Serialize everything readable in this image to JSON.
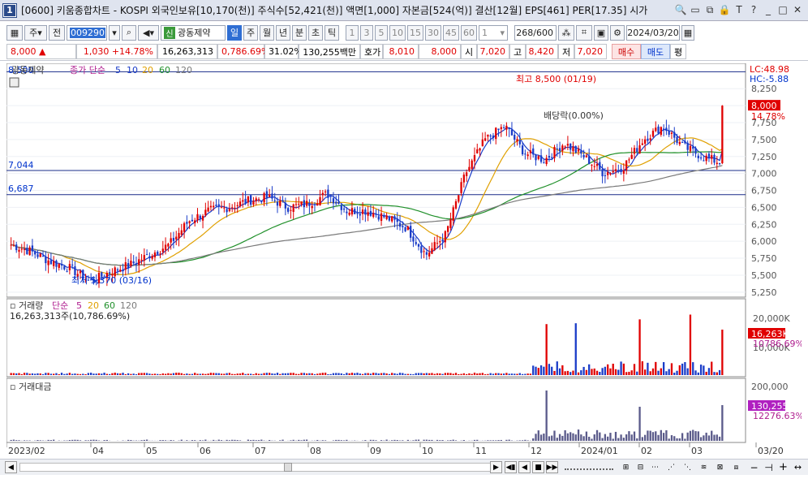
{
  "title": {
    "text": "[0600] 키움종합차트 - KOSPI 외국인보유[10,170(천)] 주식수[52,421(천)] 액면[1,000] 자본금[524(억)] 결산[12월] EPS[461] PER[17.35] 시가",
    "number": "1",
    "controls": [
      "🔍",
      "▭",
      "⧉",
      "🔒",
      "T",
      "?",
      "_",
      "□",
      "✕"
    ]
  },
  "toolbar": {
    "market": "주",
    "whole": "전",
    "code": "009290",
    "sound_icon": "speaker-icon",
    "new_badge": "신",
    "stock_name": "광동제약",
    "periods": [
      "일",
      "주",
      "월",
      "년",
      "분",
      "초",
      "틱"
    ],
    "active_period": "일",
    "intervals": [
      "1",
      "3",
      "5",
      "10",
      "15",
      "30",
      "45",
      "60"
    ],
    "interval_value": "1",
    "count": "268",
    "count_max": "/600",
    "date": "2024/03/20"
  },
  "quote": {
    "price": "8,000",
    "arrow": "▲",
    "change": "1,030",
    "change_pct": "+14.78%",
    "volume": "16,263,313",
    "volume_ratio": "0,786.69%",
    "rate": "31.02%",
    "amount": "130,255백만",
    "hoga_label": "호가",
    "ask": "8,010",
    "bid": "8,000",
    "open_label": "시",
    "open": "7,020",
    "high_label": "고",
    "high": "8,420",
    "low_label": "저",
    "low": "7,020",
    "buy": "매수",
    "sell": "매도",
    "avg": "평"
  },
  "price_panel": {
    "legend_name": "광동제약",
    "legend_ma": "종가 단순",
    "ma_periods": [
      "5",
      "10",
      "20",
      "60",
      "120"
    ],
    "ma_colors": [
      "#1a3cc8",
      "#1a3cc8",
      "#e0a000",
      "#20902a",
      "#7a7a7a"
    ],
    "lc": "LC:48.98",
    "hc": "HC:-5.88",
    "price_badge": "8,000",
    "pct_badge": "14.78%",
    "max_label": "최고 8,500 (01/19)",
    "min_label": "최저 5,370 (03/16)",
    "dividend_label": "배당락(0.00%)",
    "line_8500": "8,500",
    "line_7044": "7,044",
    "line_6687": "6,687",
    "y_ticks": [
      "8,250",
      "8,000",
      "7,750",
      "7,500",
      "7,250",
      "7,000",
      "6,750",
      "6,500",
      "6,250",
      "6,000",
      "5,750",
      "5,500",
      "5,250"
    ]
  },
  "volume_panel": {
    "title": "거래량",
    "ma": "단순",
    "ma_periods": [
      "5",
      "20",
      "60",
      "120"
    ],
    "value": "16,263,313주(10,786.69%)",
    "y_ticks": [
      "20,000K",
      "10,000K"
    ],
    "badge": "16,263K",
    "badge2": "10786.69%"
  },
  "amount_panel": {
    "title": "거래대금",
    "y_ticks": [
      "200,000"
    ],
    "badge": "130,255",
    "badge2": "12276.63%"
  },
  "x_axis": [
    "2023/02",
    "04",
    "05",
    "06",
    "07",
    "08",
    "09",
    "10",
    "11",
    "12",
    "2024/01",
    "02",
    "03",
    "03/20"
  ],
  "chart_data": {
    "type": "candlestick",
    "ylim": [
      5200,
      8600
    ],
    "x": [
      "2023/02",
      "04",
      "05",
      "06",
      "07",
      "08",
      "09",
      "10",
      "11",
      "12",
      "2024/01",
      "02",
      "03",
      "03/20"
    ],
    "close_path": [
      5950,
      5850,
      5700,
      5600,
      5400,
      5550,
      5650,
      5800,
      5950,
      6300,
      6450,
      6500,
      6600,
      6650,
      6500,
      6550,
      6700,
      6450,
      6450,
      6350,
      6200,
      5800,
      6100,
      7000,
      7500,
      7700,
      7300,
      7200,
      7450,
      7250,
      7000,
      7100,
      7500,
      7700,
      7400,
      7250,
      7150,
      8000
    ],
    "max": {
      "value": 8500,
      "date": "01/19"
    },
    "min": {
      "value": 5370,
      "date": "03/16"
    },
    "ref_lines": [
      8500,
      7044,
      6687
    ],
    "last_price": 8000
  }
}
